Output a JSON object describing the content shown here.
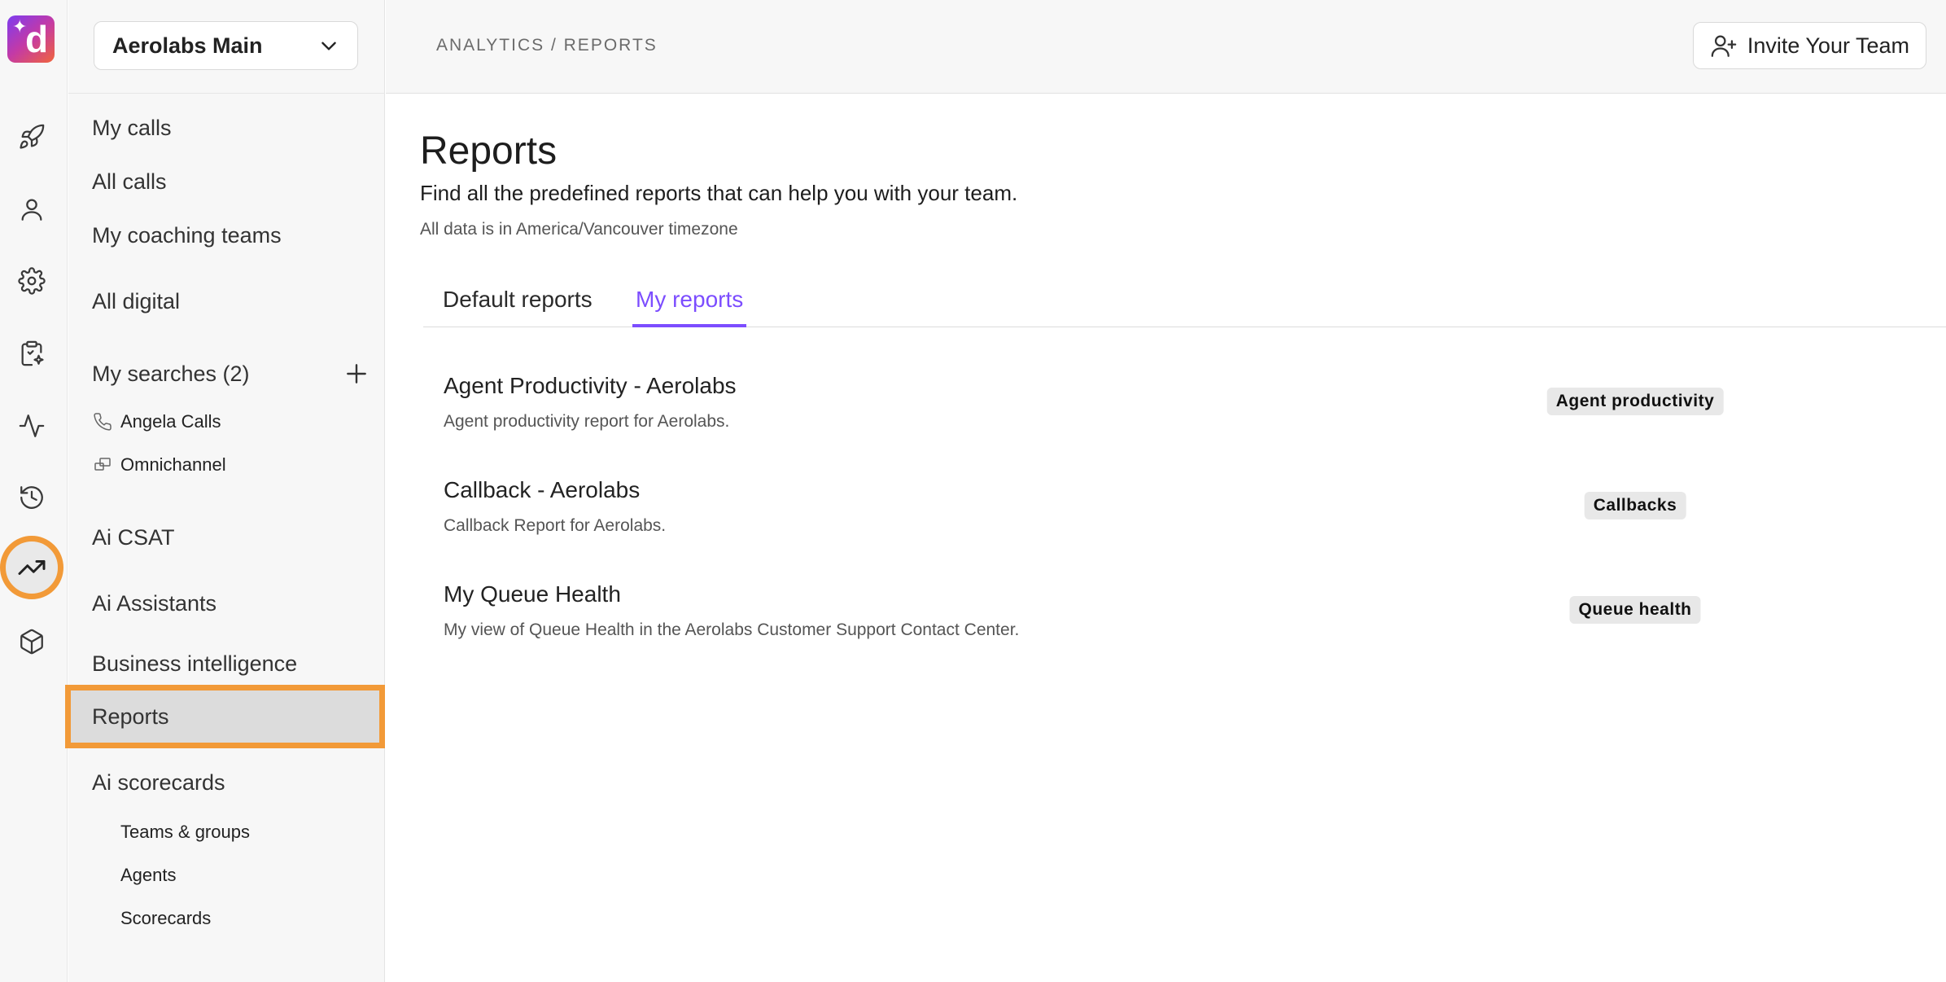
{
  "app": {
    "workspace": "Aerolabs Main"
  },
  "rail": {
    "items": [
      {
        "icon": "rocket-icon"
      },
      {
        "icon": "user-icon"
      },
      {
        "icon": "gear-icon"
      },
      {
        "icon": "clipboard-sparkle-icon"
      },
      {
        "icon": "pulse-icon"
      },
      {
        "icon": "history-icon"
      },
      {
        "icon": "trending-up-icon",
        "active": true
      },
      {
        "icon": "box-icon"
      }
    ]
  },
  "sidebar": {
    "my_calls": "My calls",
    "all_calls": "All calls",
    "coaching": "My coaching teams",
    "all_digital": "All digital",
    "searches_label": "My searches (2)",
    "searches": [
      {
        "label": "Angela Calls",
        "icon": "phone-icon"
      },
      {
        "label": "Omnichannel",
        "icon": "chat-icon"
      }
    ],
    "ai_csat": "Ai CSAT",
    "ai_assistants": "Ai Assistants",
    "bi": "Business intelligence",
    "reports": "Reports",
    "ai_scorecards": "Ai scorecards",
    "scorecard_items": [
      "Teams & groups",
      "Agents",
      "Scorecards"
    ]
  },
  "header": {
    "breadcrumb": "ANALYTICS / REPORTS",
    "invite_label": "Invite Your Team"
  },
  "main": {
    "title": "Reports",
    "subtitle": "Find all the predefined reports that can help you with your team.",
    "timezone": "All data is in America/Vancouver timezone",
    "tabs": [
      {
        "label": "Default reports",
        "active": false
      },
      {
        "label": "My reports",
        "active": true
      }
    ],
    "reports": [
      {
        "title": "Agent Productivity - Aerolabs",
        "description": "Agent productivity report for Aerolabs.",
        "tag": "Agent productivity"
      },
      {
        "title": "Callback - Aerolabs",
        "description": "Callback Report for Aerolabs.",
        "tag": "Callbacks"
      },
      {
        "title": "My Queue Health",
        "description": "My view of Queue Health in the Aerolabs Customer Support Contact Center.",
        "tag": "Queue health"
      }
    ]
  },
  "colors": {
    "accent": "#7c4dff",
    "highlight": "#f29a38"
  }
}
